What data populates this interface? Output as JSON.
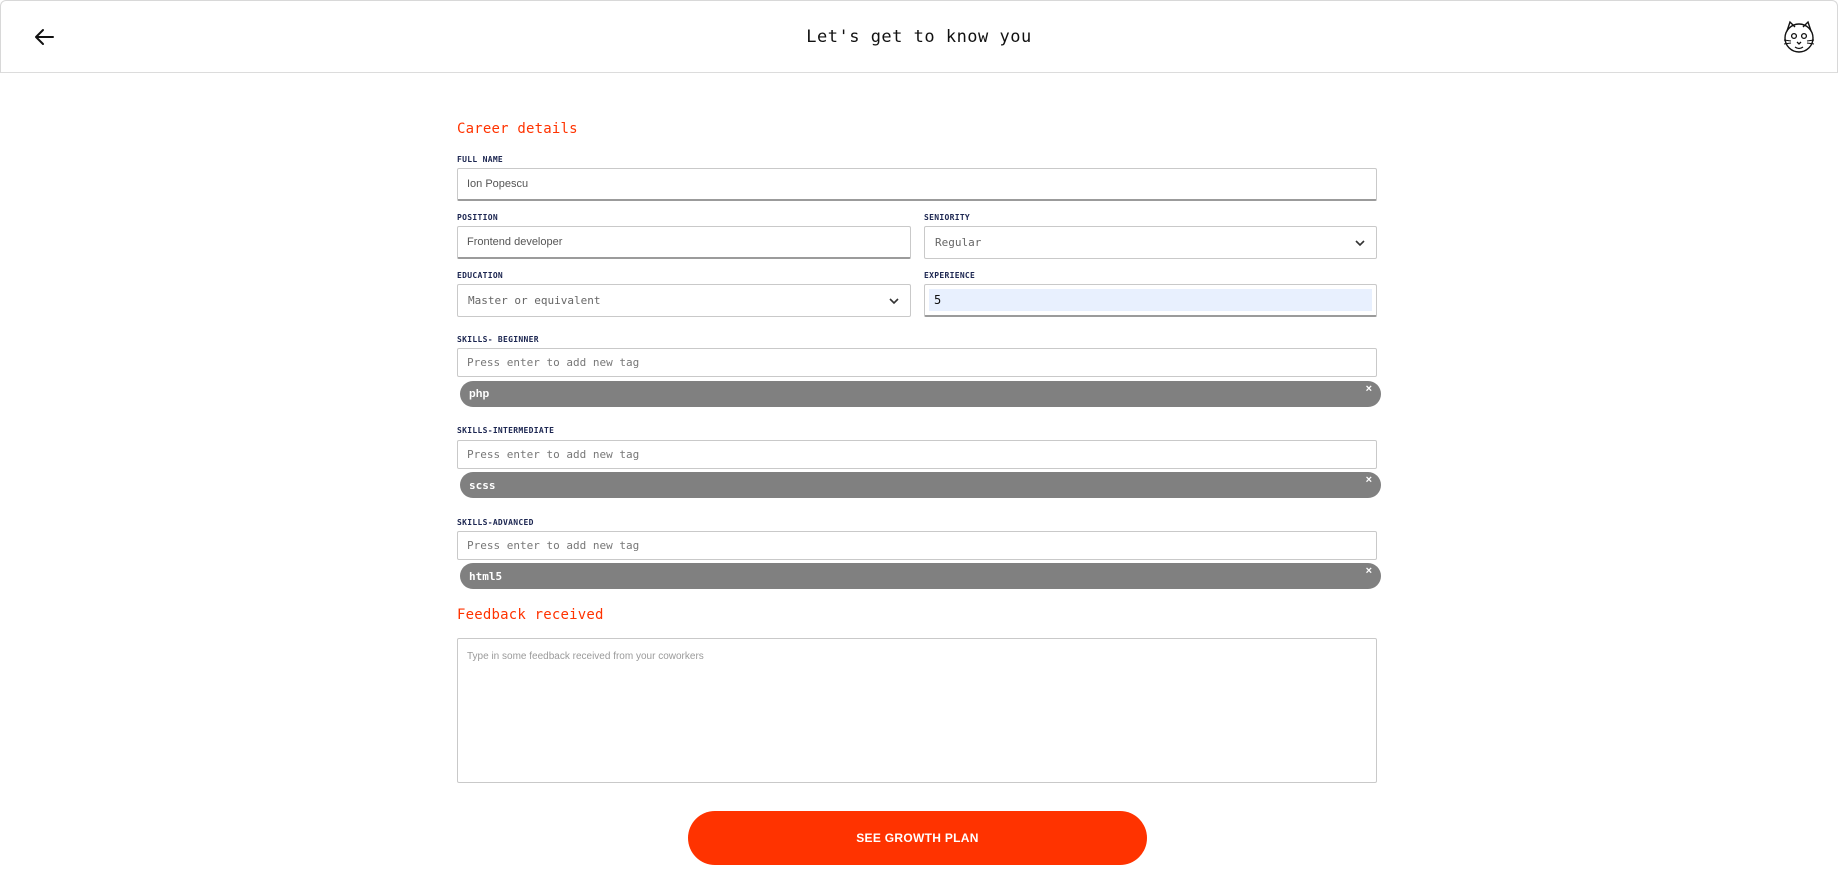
{
  "header": {
    "title": "Let's get to know you",
    "back_icon": "arrow-left-icon",
    "avatar_icon": "cat-avatar-icon"
  },
  "career": {
    "section_title": "Career details",
    "full_name": {
      "label": "FULL NAME",
      "value": "Ion Popescu"
    },
    "position": {
      "label": "POSITION",
      "value": "Frontend developer"
    },
    "seniority": {
      "label": "SENIORITY",
      "selected": "Regular"
    },
    "education": {
      "label": "EDUCATION",
      "selected": "Master or equivalent"
    },
    "experience": {
      "label": "EXPERIENCE",
      "value": "5"
    }
  },
  "skills": {
    "beginner": {
      "label": "SKILLS- BEGINNER",
      "placeholder": "Press enter to add new tag",
      "tags": [
        "php"
      ]
    },
    "intermediate": {
      "label": "SKILLS-INTERMEDIATE",
      "placeholder": "Press enter to add new tag",
      "tags": [
        "scss"
      ]
    },
    "advanced": {
      "label": "SKILLS-ADVANCED",
      "placeholder": "Press enter to add new tag",
      "tags": [
        "html5"
      ]
    },
    "remove_symbol": "×"
  },
  "feedback": {
    "section_title": "Feedback received",
    "placeholder": "Type in some feedback received from your coworkers"
  },
  "cta": {
    "label": "SEE GROWTH PLAN"
  },
  "colors": {
    "accent": "#ff3300",
    "tag_bg": "#808080",
    "label": "#1b2550"
  }
}
